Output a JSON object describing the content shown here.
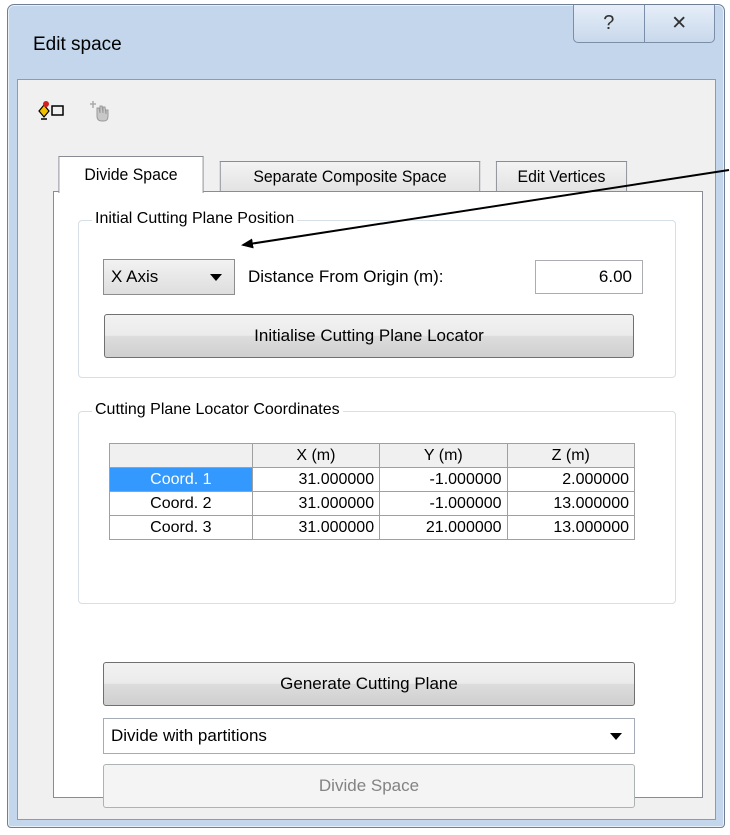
{
  "window": {
    "title": "Edit space",
    "help_symbol": "?",
    "close_symbol": "✕"
  },
  "toolbar": {
    "tools": [
      {
        "icon": "divide-space-tool-icon"
      },
      {
        "icon": "select-vertex-tool-icon"
      }
    ]
  },
  "tabs": [
    {
      "label": "Divide Space",
      "active": true
    },
    {
      "label": "Separate Composite Space",
      "active": false
    },
    {
      "label": "Edit Vertices",
      "active": false
    }
  ],
  "initial_plane": {
    "group_label": "Initial Cutting Plane Position",
    "axis_value": "X Axis",
    "distance_label": "Distance From Origin (m):",
    "distance_value": "6.00",
    "initialise_button": "Initialise Cutting Plane Locator"
  },
  "locator": {
    "group_label": "Cutting Plane Locator Coordinates",
    "columns": [
      "",
      "X (m)",
      "Y (m)",
      "Z (m)"
    ],
    "rows": [
      {
        "name": "Coord. 1",
        "x": "31.000000",
        "y": "-1.000000",
        "z": "2.000000",
        "selected": true
      },
      {
        "name": "Coord. 2",
        "x": "31.000000",
        "y": "-1.000000",
        "z": "13.000000",
        "selected": false
      },
      {
        "name": "Coord. 3",
        "x": "31.000000",
        "y": "21.000000",
        "z": "13.000000",
        "selected": false
      }
    ]
  },
  "generate_button": "Generate Cutting Plane",
  "divide_mode_value": "Divide with partitions",
  "divide_button": "Divide Space",
  "colors": {
    "selection": "#3399ff",
    "frame": "#c3d6ec"
  }
}
